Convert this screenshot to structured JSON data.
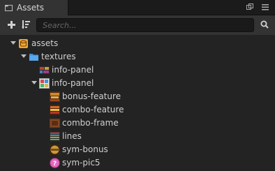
{
  "panel": {
    "tab_title": "Assets"
  },
  "toolbar": {
    "search_placeholder": "Search..."
  },
  "tree": {
    "root": "assets",
    "folder": "textures",
    "items": [
      "info-panel",
      "info-panel",
      "bonus-feature",
      "combo-feature",
      "combo-frame",
      "lines",
      "sym-bonus",
      "sym-pic5"
    ]
  },
  "colors": {
    "background": "#232323",
    "toolbar": "#333333",
    "folder_blue": "#3f8fd8",
    "db_orange": "#f1a531"
  }
}
